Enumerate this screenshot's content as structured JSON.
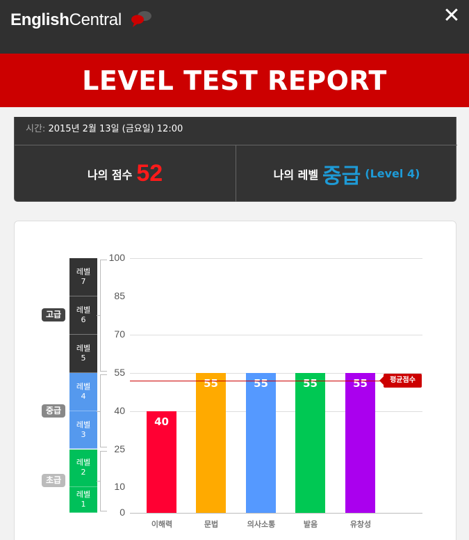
{
  "header": {
    "logo_bold": "English",
    "logo_light": "Central",
    "close_glyph": "✕"
  },
  "banner": {
    "title": "LEVEL TEST REPORT"
  },
  "info": {
    "time_label": "시간:",
    "time_value": "2015년 2월 13일 (금요일) 12:00",
    "score_label": "나의 점수",
    "score_value": "52",
    "level_label": "나의 레벨",
    "level_name": "중급",
    "level_sub": "(Level 4)"
  },
  "levels": {
    "bands": [
      {
        "label": "레벨",
        "num": "7"
      },
      {
        "label": "레벨",
        "num": "6"
      },
      {
        "label": "레벨",
        "num": "5"
      },
      {
        "label": "레벨",
        "num": "4"
      },
      {
        "label": "레벨",
        "num": "3"
      },
      {
        "label": "레벨",
        "num": "2"
      },
      {
        "label": "레벨",
        "num": "1"
      }
    ],
    "tiers": [
      "고급",
      "중급",
      "초급"
    ]
  },
  "colors": {
    "advanced": "#333333",
    "intermediate": "#5599ee",
    "beginner": "#00c05a",
    "accent_red": "#cc0000",
    "level_blue": "#1e9bd7"
  },
  "chart_data": {
    "type": "bar",
    "categories": [
      "이해력",
      "문법",
      "의사소통",
      "발음",
      "유창성"
    ],
    "values": [
      40,
      55,
      55,
      55,
      55
    ],
    "colors": [
      "#ff0033",
      "#ffaa00",
      "#5599ff",
      "#00c853",
      "#aa00ee"
    ],
    "yticks": [
      0,
      10,
      25,
      40,
      55,
      70,
      85,
      100
    ],
    "ylim": [
      0,
      100
    ],
    "average": 52,
    "average_label": "평균점수",
    "grid": true
  }
}
